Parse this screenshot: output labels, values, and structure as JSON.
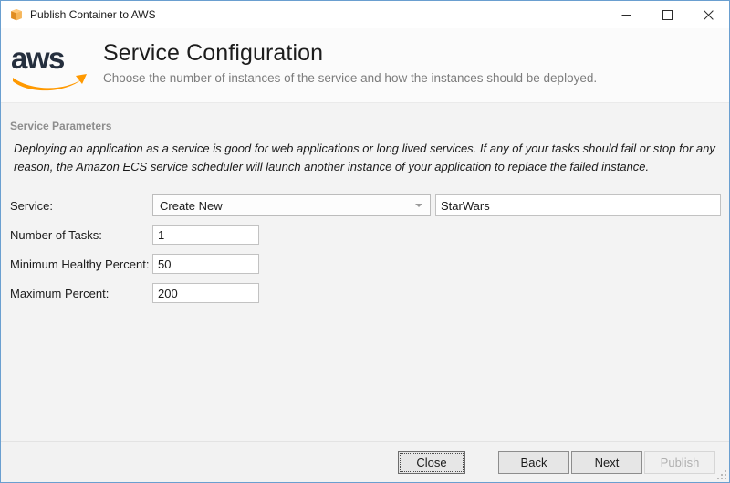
{
  "window": {
    "title": "Publish Container to AWS",
    "icon": "container-box-icon",
    "border_color": "#6a9fd0",
    "controls": [
      {
        "name": "minimize",
        "glyph": "minimize-icon"
      },
      {
        "name": "maximize",
        "glyph": "maximize-icon"
      },
      {
        "name": "close",
        "glyph": "close-icon"
      }
    ]
  },
  "header": {
    "logo": "aws-logo",
    "logo_text": "aws",
    "title": "Service Configuration",
    "subtitle": "Choose the number of instances of the service and how the instances should be deployed.",
    "brand_orange": "#ff9900",
    "brand_navy": "#252f3e"
  },
  "section": {
    "title": "Service Parameters",
    "description": "Deploying an application as a service is good for web applications or long lived services. If any of your tasks should fail or stop for any reason, the Amazon ECS service scheduler will launch another instance of your application to replace the failed instance."
  },
  "form": {
    "service": {
      "label": "Service:",
      "selected": "Create New",
      "options": [
        "Create New"
      ],
      "name_value": "StarWars",
      "name_placeholder": ""
    },
    "number_of_tasks": {
      "label": "Number of Tasks:",
      "value": "1"
    },
    "minimum_healthy_percent": {
      "label": "Minimum Healthy Percent:",
      "value": "50"
    },
    "maximum_percent": {
      "label": "Maximum Percent:",
      "value": "200"
    }
  },
  "footer": {
    "close_label": "Close",
    "back_label": "Back",
    "next_label": "Next",
    "publish_label": "Publish"
  }
}
